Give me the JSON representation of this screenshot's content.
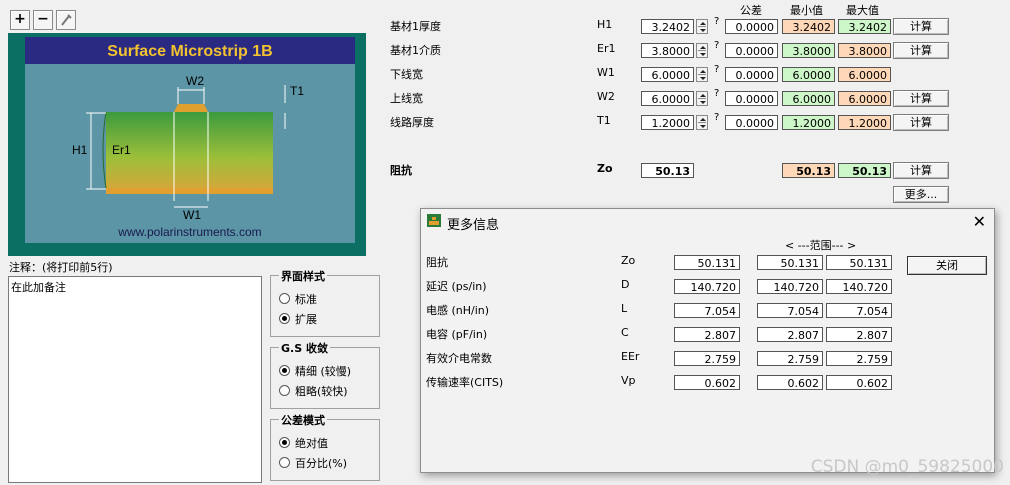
{
  "toolbar": {
    "plus": "+",
    "minus": "−",
    "pick_icon": "eyedropper-icon"
  },
  "diagram": {
    "title": "Surface Microstrip 1B",
    "labels": {
      "w2": "W2",
      "t1": "T1",
      "h1": "H1",
      "er1": "Er1",
      "w1": "W1"
    },
    "url": "www.polarinstruments.com",
    "colors": {
      "bg": "#0b6f63",
      "title_bg": "#2a2a82",
      "title_text": "#f2c230",
      "panel": "#5b95a6",
      "substrate": "#4aa642",
      "copper": "#e0a030"
    }
  },
  "notes": {
    "label": "注释：(将打印前5行)",
    "text": "在此加备注"
  },
  "groups": {
    "ui_style": {
      "title": "界面样式",
      "options": [
        "标准",
        "扩展"
      ],
      "selected": 1
    },
    "convergence": {
      "title": "G.S 收敛",
      "options": [
        "精细 (较慢)",
        "粗略(较快)"
      ],
      "selected": 0
    },
    "tolerance_mode": {
      "title": "公差模式",
      "options": [
        "绝对值",
        "百分比(%)"
      ],
      "selected": 0
    }
  },
  "columns": {
    "tolerance": "公差",
    "min": "最小值",
    "max": "最大值"
  },
  "params": [
    {
      "label": "基材1厚度",
      "symbol": "H1",
      "value": "3.2402",
      "tolerance": "0.0000",
      "min": "3.2402",
      "max": "3.2402",
      "min_color": "peach",
      "max_color": "green",
      "calc": "计算"
    },
    {
      "label": "基材1介质",
      "symbol": "Er1",
      "value": "3.8000",
      "tolerance": "0.0000",
      "min": "3.8000",
      "max": "3.8000",
      "min_color": "green",
      "max_color": "peach",
      "calc": "计算"
    },
    {
      "label": "下线宽",
      "symbol": "W1",
      "value": "6.0000",
      "tolerance": "0.0000",
      "min": "6.0000",
      "max": "6.0000",
      "min_color": "green",
      "max_color": "peach",
      "calc": ""
    },
    {
      "label": "上线宽",
      "symbol": "W2",
      "value": "6.0000",
      "tolerance": "0.0000",
      "min": "6.0000",
      "max": "6.0000",
      "min_color": "green",
      "max_color": "peach",
      "calc": "计算"
    },
    {
      "label": "线路厚度",
      "symbol": "T1",
      "value": "1.2000",
      "tolerance": "0.0000",
      "min": "1.2000",
      "max": "1.2000",
      "min_color": "green",
      "max_color": "peach",
      "calc": "计算"
    }
  ],
  "impedance": {
    "label": "阻抗",
    "symbol": "Zo",
    "value": "50.13",
    "min": "50.13",
    "max": "50.13",
    "calc": "计算",
    "more": "更多..."
  },
  "dialog": {
    "title": "更多信息",
    "range_header": "< ---范围--- >",
    "close_label": "关闭",
    "rows": [
      {
        "label": "阻抗",
        "symbol": "Zo",
        "value": "50.131",
        "min": "50.131",
        "max": "50.131"
      },
      {
        "label": "延迟 (ps/in)",
        "symbol": "D",
        "value": "140.720",
        "min": "140.720",
        "max": "140.720"
      },
      {
        "label": "电感 (nH/in)",
        "symbol": "L",
        "value": "7.054",
        "min": "7.054",
        "max": "7.054"
      },
      {
        "label": "电容 (pF/in)",
        "symbol": "C",
        "value": "2.807",
        "min": "2.807",
        "max": "2.807"
      },
      {
        "label": "有效介电常数",
        "symbol": "EEr",
        "value": "2.759",
        "min": "2.759",
        "max": "2.759"
      },
      {
        "label": "传输速率(CITS)",
        "symbol": "Vp",
        "value": "0.602",
        "min": "0.602",
        "max": "0.602"
      }
    ]
  },
  "watermark": "CSDN @m0_59825000"
}
